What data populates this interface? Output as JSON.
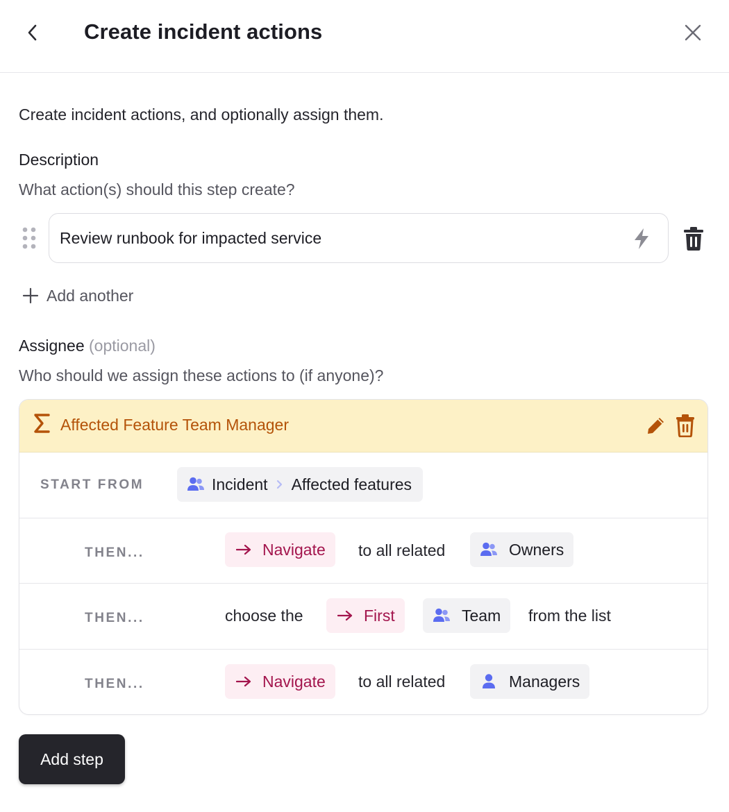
{
  "header": {
    "title": "Create incident actions"
  },
  "intro": "Create incident actions, and optionally assign them.",
  "description": {
    "label": "Description",
    "help": "What action(s) should this step create?",
    "actions": [
      {
        "value": "Review runbook for impacted service"
      }
    ],
    "add_another": "Add another"
  },
  "assignee": {
    "label": "Assignee",
    "optional": "(optional)",
    "help": "Who should we assign these actions to (if anyone)?"
  },
  "expression": {
    "title": "Affected Feature Team Manager",
    "start_from": {
      "label": "START FROM",
      "root": "Incident",
      "path": "Affected features"
    },
    "steps": [
      {
        "label": "THEN...",
        "operation": "Navigate",
        "connector": "to all related",
        "target": "Owners",
        "target_icon": "users-icon"
      },
      {
        "label": "THEN...",
        "prefix": "choose the",
        "operation": "First",
        "target": "Team",
        "suffix": "from the list",
        "target_icon": "users-icon"
      },
      {
        "label": "THEN...",
        "operation": "Navigate",
        "connector": "to all related",
        "target": "Managers",
        "target_icon": "user-icon"
      }
    ]
  },
  "footer": {
    "add_step": "Add step"
  },
  "colors": {
    "accent_amber": "#b45309",
    "header_bg": "#fdf1c6",
    "operation_pink": "#a3154d",
    "operation_pink_bg": "#fdeef3",
    "icon_indigo": "#5b6cf0",
    "primary_button": "#25252b"
  }
}
